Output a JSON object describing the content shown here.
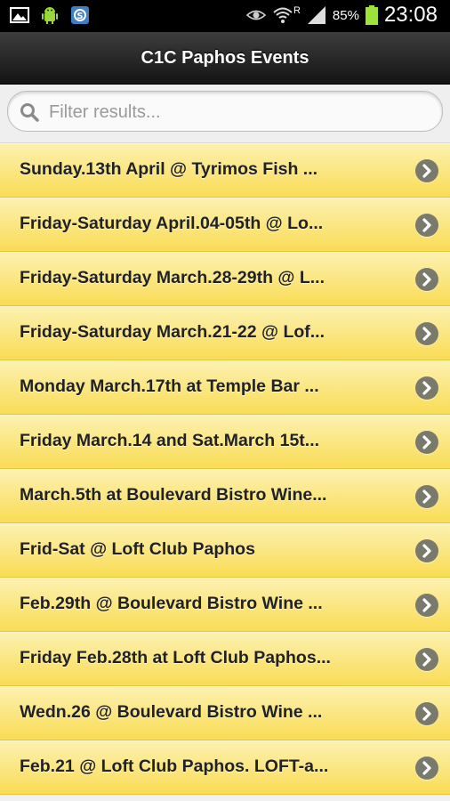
{
  "status_bar": {
    "battery": "85%",
    "time": "23:08",
    "network_indicator": "R"
  },
  "header": {
    "title": "C1C Paphos Events"
  },
  "search": {
    "placeholder": "Filter results..."
  },
  "events": [
    {
      "label": "Sunday.13th April @ Tyrimos Fish ..."
    },
    {
      "label": "Friday-Saturday April.04-05th @ Lo..."
    },
    {
      "label": "Friday-Saturday March.28-29th @ L..."
    },
    {
      "label": "Friday-Saturday March.21-22 @ Lof..."
    },
    {
      "label": "Monday March.17th at Temple Bar ..."
    },
    {
      "label": "Friday March.14 and Sat.March 15t..."
    },
    {
      "label": "March.5th at Boulevard Bistro Wine..."
    },
    {
      "label": "Frid-Sat @ Loft Club Paphos"
    },
    {
      "label": "Feb.29th @ Boulevard Bistro Wine ..."
    },
    {
      "label": "Friday Feb.28th at Loft Club Paphos..."
    },
    {
      "label": "Wedn.26 @ Boulevard Bistro Wine ..."
    },
    {
      "label": "Feb.21 @ Loft Club Paphos. LOFT-a..."
    }
  ],
  "colors": {
    "list_item_top": "#fcf1b0",
    "list_item_bottom": "#f9dc55",
    "header_bg": "#1f1f1f",
    "chevron_bg": "#7a7a6c"
  }
}
